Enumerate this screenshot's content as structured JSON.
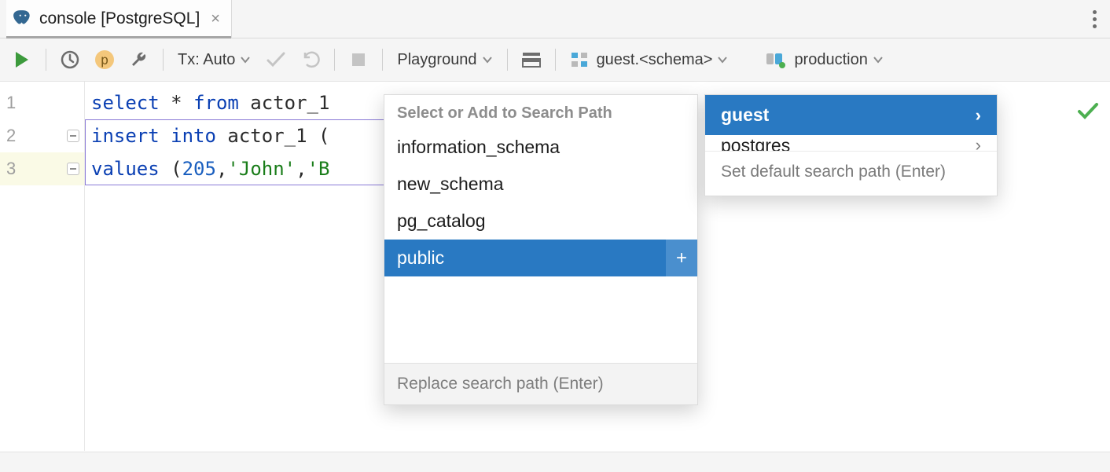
{
  "tab": {
    "title": "console [PostgreSQL]"
  },
  "toolbar": {
    "tx_label": "Tx: Auto",
    "playground_label": "Playground",
    "schema_label": "guest.<schema>",
    "session_label": "production"
  },
  "gutter": {
    "lines": [
      "1",
      "2",
      "3"
    ]
  },
  "code": {
    "line1": {
      "kw1": "select",
      "rest": " * ",
      "kw2": "from",
      "tbl": " actor_1"
    },
    "line2": {
      "kw1": "insert into",
      "tbl": " actor_1 ("
    },
    "line3": {
      "kw1": "values",
      "open": " (",
      "num": "205",
      "c1": ",",
      "s1": "'John'",
      "c2": ",",
      "s2": "'B"
    }
  },
  "schema_popup": {
    "header": "Select or Add to Search Path",
    "items": [
      "information_schema",
      "new_schema",
      "pg_catalog",
      "public"
    ],
    "selected": "public",
    "footer": "Replace search path (Enter)"
  },
  "db_popup": {
    "items": [
      "guest",
      "postgres"
    ],
    "selected": "guest",
    "footer": "Set default search path (Enter)"
  }
}
